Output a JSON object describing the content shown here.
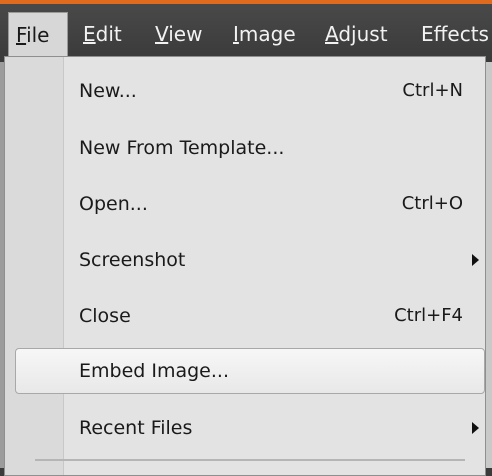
{
  "menubar": {
    "items": [
      {
        "hot": "F",
        "rest": "ile"
      },
      {
        "hot": "E",
        "rest": "dit"
      },
      {
        "hot": "V",
        "rest": "iew"
      },
      {
        "hot": "I",
        "rest": "mage"
      },
      {
        "hot": "A",
        "rest": "djust"
      },
      {
        "hot": "",
        "rest": "Effects"
      }
    ]
  },
  "file_menu": {
    "items": [
      {
        "label": "New...",
        "shortcut": "Ctrl+N"
      },
      {
        "label": "New From Template...",
        "shortcut": ""
      },
      {
        "label": "Open...",
        "shortcut": "Ctrl+O"
      },
      {
        "label": "Screenshot",
        "shortcut": "",
        "submenu": true
      },
      {
        "label": "Close",
        "shortcut": "Ctrl+F4"
      },
      {
        "label": "Embed Image...",
        "shortcut": "",
        "highlighted": true
      },
      {
        "label": "Recent Files",
        "shortcut": "",
        "submenu": true
      }
    ]
  },
  "colors": {
    "accent": "#e06a1d",
    "menubar_bg": "#3f3f3f",
    "menu_bg": "#e3e3e3"
  }
}
